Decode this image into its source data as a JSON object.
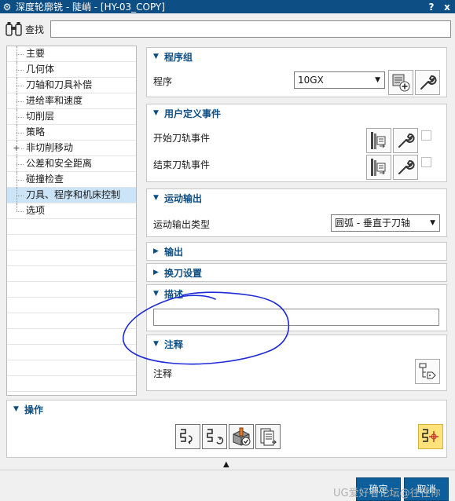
{
  "window": {
    "title": "深度轮廓铣 - 陡峭 - [HY-03_COPY]",
    "help_label": "?",
    "close_label": "x"
  },
  "search": {
    "label": "查找",
    "value": ""
  },
  "nav": {
    "items": [
      {
        "label": "主要",
        "expandable": false,
        "selected": false
      },
      {
        "label": "几何体",
        "expandable": false,
        "selected": false
      },
      {
        "label": "刀轴和刀具补偿",
        "expandable": false,
        "selected": false
      },
      {
        "label": "进给率和速度",
        "expandable": false,
        "selected": false
      },
      {
        "label": "切削层",
        "expandable": false,
        "selected": false
      },
      {
        "label": "策略",
        "expandable": false,
        "selected": false
      },
      {
        "label": "非切削移动",
        "expandable": true,
        "selected": false
      },
      {
        "label": "公差和安全距离",
        "expandable": false,
        "selected": false
      },
      {
        "label": "碰撞检查",
        "expandable": false,
        "selected": false
      },
      {
        "label": "刀具、程序和机床控制",
        "expandable": false,
        "selected": true
      },
      {
        "label": "选项",
        "expandable": false,
        "selected": false
      }
    ],
    "expand_symbol": "+"
  },
  "sections": {
    "program_group": {
      "title": "程序组",
      "program_label": "程序",
      "program_value": "10GX"
    },
    "user_events": {
      "title": "用户定义事件",
      "start_label": "开始刀轨事件",
      "end_label": "结束刀轨事件",
      "start_checked": false,
      "end_checked": false
    },
    "motion_output": {
      "title": "运动输出",
      "type_label": "运动输出类型",
      "type_value": "圆弧 - 垂直于刀轴"
    },
    "output": {
      "title": "输出"
    },
    "tool_change": {
      "title": "换刀设置"
    },
    "description": {
      "title": "描述",
      "value": ""
    },
    "notes": {
      "title": "注释",
      "notes_label": "注释"
    }
  },
  "operations": {
    "title": "操作"
  },
  "buttons": {
    "ok": "确定",
    "cancel": "取消"
  },
  "watermark": "UG爱好者论坛@往往你",
  "colors": {
    "titlebar": "#0d4f84",
    "section_title": "#0d4f84",
    "selected_row": "#cce4f7",
    "primary_button": "#0d5f9c",
    "highlight_button": "#ffe27a",
    "annotation_ink": "#1f2bd8"
  }
}
